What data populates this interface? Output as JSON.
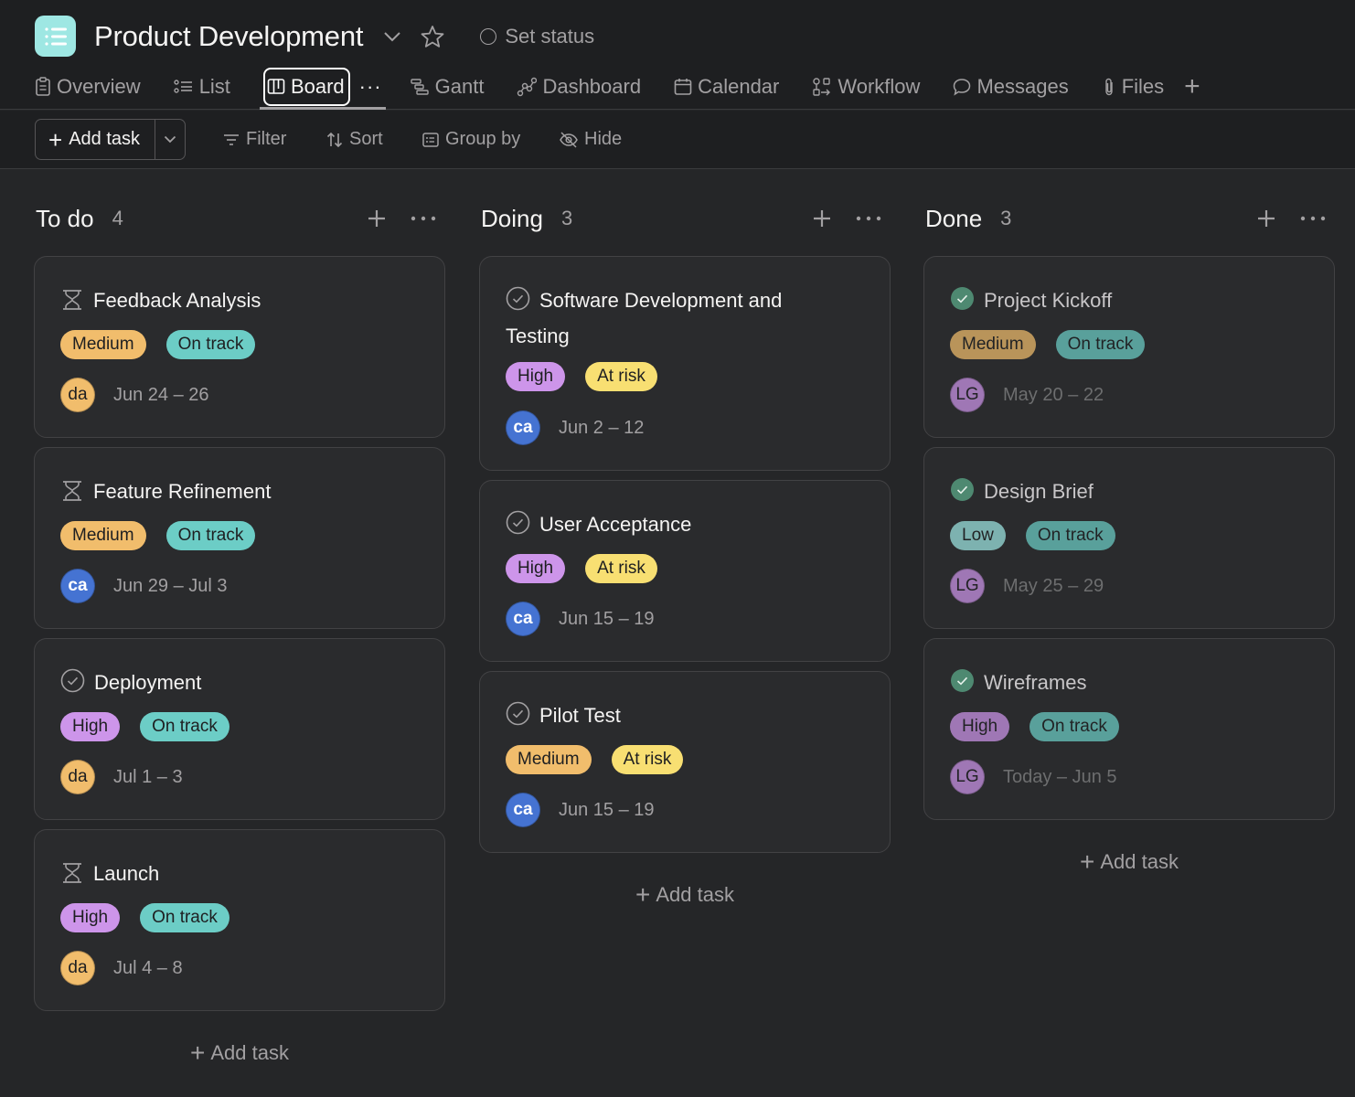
{
  "project": {
    "title": "Product Development",
    "set_status_label": "Set status"
  },
  "tabs": [
    {
      "label": "Overview",
      "icon": "clipboard-icon"
    },
    {
      "label": "List",
      "icon": "list-icon"
    },
    {
      "label": "Board",
      "icon": "board-icon",
      "active": true
    },
    {
      "label": "Gantt",
      "icon": "gantt-icon"
    },
    {
      "label": "Dashboard",
      "icon": "dashboard-icon"
    },
    {
      "label": "Calendar",
      "icon": "calendar-icon"
    },
    {
      "label": "Workflow",
      "icon": "workflow-icon"
    },
    {
      "label": "Messages",
      "icon": "message-icon"
    },
    {
      "label": "Files",
      "icon": "paperclip-icon"
    }
  ],
  "tab_more": "···",
  "toolbar": {
    "add_task_label": "Add task",
    "filter_label": "Filter",
    "sort_label": "Sort",
    "group_by_label": "Group by",
    "hide_label": "Hide"
  },
  "colors": {
    "medium": "#f1bd6c",
    "high": "#cd95ea",
    "low": "#9ee7e3",
    "on_track": "#6ccdc6",
    "at_risk": "#f8df72",
    "avatar_da": "#f1bd6c",
    "avatar_ca": "#4573d2",
    "avatar_lg": "#cd95ea",
    "done_check": "#58a182"
  },
  "columns": [
    {
      "name": "To do",
      "count": "4",
      "add_task_label": "Add task",
      "cards": [
        {
          "title": "Feedback Analysis",
          "icon": "hourglass",
          "priority": "Medium",
          "status": "On track",
          "assignee": "da",
          "dates": "Jun 24 – 26"
        },
        {
          "title": "Feature Refinement",
          "icon": "hourglass",
          "priority": "Medium",
          "status": "On track",
          "assignee": "ca",
          "dates": "Jun 29 – Jul 3"
        },
        {
          "title": "Deployment",
          "icon": "check-circle",
          "priority": "High",
          "status": "On track",
          "assignee": "da",
          "dates": "Jul 1 – 3"
        },
        {
          "title": "Launch",
          "icon": "hourglass",
          "priority": "High",
          "status": "On track",
          "assignee": "da",
          "dates": "Jul 4 – 8"
        }
      ]
    },
    {
      "name": "Doing",
      "count": "3",
      "add_task_label": "Add task",
      "cards": [
        {
          "title": "Software Development and Testing",
          "icon": "check-circle",
          "priority": "High",
          "status": "At risk",
          "assignee": "ca",
          "dates": "Jun 2 – 12"
        },
        {
          "title": "User Acceptance",
          "icon": "check-circle",
          "priority": "High",
          "status": "At risk",
          "assignee": "ca",
          "dates": "Jun 15 – 19"
        },
        {
          "title": "Pilot Test",
          "icon": "check-circle",
          "priority": "Medium",
          "status": "At risk",
          "assignee": "ca",
          "dates": "Jun 15 – 19"
        }
      ]
    },
    {
      "name": "Done",
      "count": "3",
      "add_task_label": "Add task",
      "cards": [
        {
          "title": "Project Kickoff",
          "icon": "completed-check",
          "priority": "Medium",
          "status": "On track",
          "assignee": "LG",
          "dates": "May 20 – 22"
        },
        {
          "title": "Design Brief",
          "icon": "completed-check",
          "priority": "Low",
          "status": "On track",
          "assignee": "LG",
          "dates": "May 25 – 29"
        },
        {
          "title": "Wireframes",
          "icon": "completed-check",
          "priority": "High",
          "status": "On track",
          "assignee": "LG",
          "dates": "Today – Jun 5"
        }
      ]
    }
  ]
}
